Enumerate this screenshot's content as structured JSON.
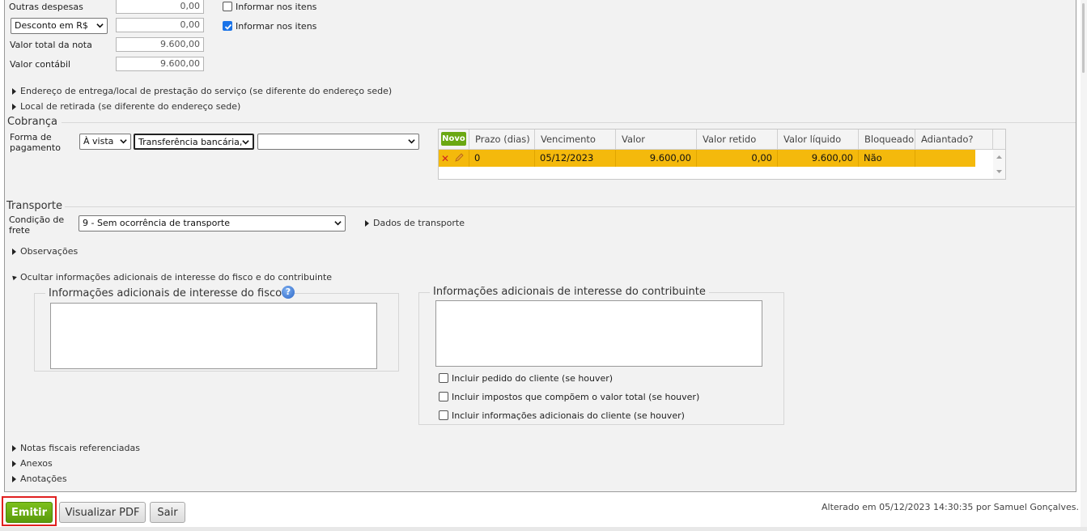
{
  "totals": {
    "outras_despesas_label": "Outras despesas",
    "outras_despesas_value": "0,00",
    "informar_nos_itens_1": "Informar nos itens",
    "informar_nos_itens_1_checked": false,
    "desconto_select": "Desconto em R$",
    "desconto_value": "0,00",
    "informar_nos_itens_2": "Informar nos itens",
    "informar_nos_itens_2_checked": true,
    "valor_total_label": "Valor total da nota",
    "valor_total_value": "9.600,00",
    "valor_contabil_label": "Valor contábil",
    "valor_contabil_value": "9.600,00"
  },
  "links": {
    "endereco_entrega": "Endereço de entrega/local de prestação do serviço (se diferente do endereço sede)",
    "local_retirada": "Local de retirada (se diferente do endereço sede)"
  },
  "cobranca": {
    "title": "Cobrança",
    "forma_label_1": "Forma de",
    "forma_label_2": "pagamento",
    "condicao_select": "À vista",
    "meio_select": "Transferência bancária,",
    "extra_select": "",
    "grid": {
      "novo_label": "Novo",
      "headers": [
        "Prazo (dias)",
        "Vencimento",
        "Valor",
        "Valor retido",
        "Valor líquido",
        "Bloqueado",
        "Adiantado?"
      ],
      "rows": [
        {
          "prazo": "0",
          "vencimento": "05/12/2023",
          "valor": "9.600,00",
          "valor_retido": "0,00",
          "valor_liquido": "9.600,00",
          "bloqueado": "Não",
          "adiantado": ""
        }
      ]
    }
  },
  "transporte": {
    "title": "Transporte",
    "condicao_label_1": "Condição de",
    "condicao_label_2": "frete",
    "condicao_select": "9 - Sem ocorrência de transporte",
    "dados_link": "Dados de transporte"
  },
  "observacoes_link": "Observações",
  "info_adicionais": {
    "toggle_label": "Ocultar informações adicionais de interesse do fisco e do contribuinte",
    "fisco_title": "Informações adicionais de interesse do fisco",
    "fisco_text": "",
    "contribuinte_title": "Informações adicionais de interesse do contribuinte",
    "contribuinte_text": "",
    "checkboxes": [
      {
        "label": "Incluir pedido do cliente (se houver)",
        "checked": false
      },
      {
        "label": "Incluir impostos que compõem o valor total (se houver)",
        "checked": false
      },
      {
        "label": "Incluir informações adicionais do cliente (se houver)",
        "checked": false
      }
    ]
  },
  "more_links": [
    "Notas fiscais referenciadas",
    "Anexos",
    "Anotações"
  ],
  "footer": {
    "emitir": "Emitir",
    "visualizar_pdf": "Visualizar PDF",
    "sair": "Sair",
    "alterado": "Alterado em 05/12/2023 14:30:35 por Samuel Gonçalves.",
    "emit_color": "#6aa812",
    "highlight_color": "#e02020"
  }
}
